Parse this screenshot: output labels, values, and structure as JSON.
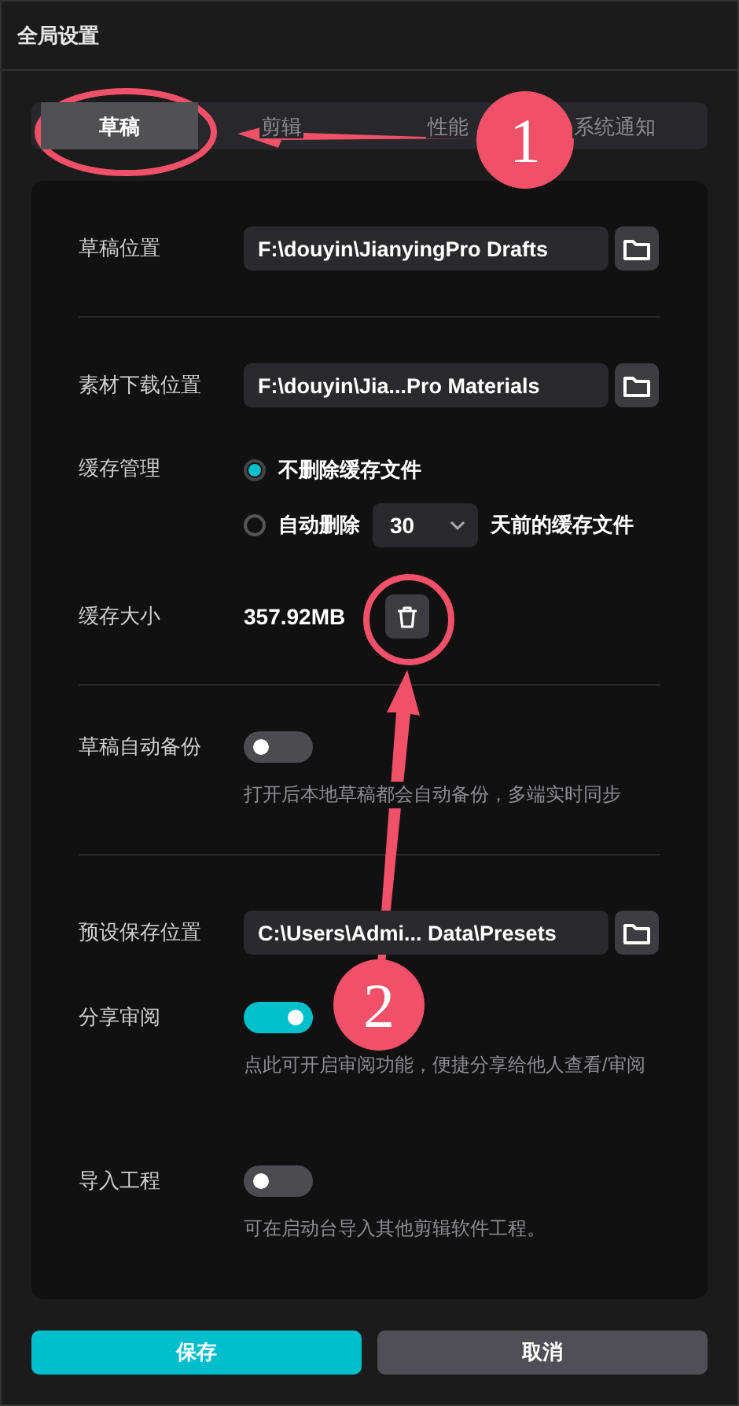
{
  "window": {
    "title": "全局设置"
  },
  "tabs": [
    {
      "label": "草稿",
      "selected": true
    },
    {
      "label": "剪辑",
      "selected": false
    },
    {
      "label": "性能",
      "selected": false
    },
    {
      "label": "系统通知",
      "selected": false
    }
  ],
  "sections": [
    [
      {
        "kind": "path",
        "label": "草稿位置",
        "value": "F:\\douyin\\JianyingPro Drafts"
      }
    ],
    [
      {
        "kind": "path",
        "label": "素材下载位置",
        "value": "F:\\douyin\\Jia...Pro Materials"
      },
      {
        "kind": "radio",
        "label": "缓存管理",
        "options": [
          {
            "label": "不删除缓存文件",
            "selected": true
          },
          {
            "label": "自动删除",
            "selected": false,
            "select_value": "30",
            "suffix": "天前的缓存文件"
          }
        ]
      },
      {
        "kind": "size",
        "label": "缓存大小",
        "value": "357.92MB"
      }
    ],
    [
      {
        "kind": "toggle",
        "label": "草稿自动备份",
        "on": false,
        "description": "打开后本地草稿都会自动备份，多端实时同步"
      }
    ],
    [
      {
        "kind": "path",
        "label": "预设保存位置",
        "value": "C:\\Users\\Admi... Data\\Presets"
      },
      {
        "kind": "toggle",
        "label": "分享审阅",
        "on": true,
        "description": "点此可开启审阅功能，便捷分享给他人查看/审阅"
      },
      {
        "kind": "toggle",
        "label": "导入工程",
        "on": false,
        "description": "可在启动台导入其他剪辑软件工程。"
      }
    ]
  ],
  "buttons": [
    {
      "label": "保存",
      "kind": "primary"
    },
    {
      "label": "取消",
      "kind": "secondary"
    }
  ],
  "annotations": [
    {
      "label": "1"
    },
    {
      "label": "2"
    }
  ]
}
